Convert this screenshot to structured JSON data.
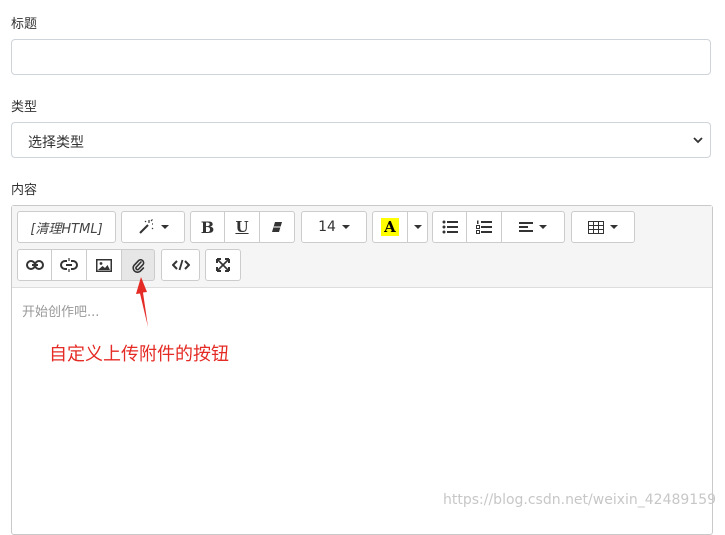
{
  "form": {
    "title_label": "标题",
    "title_value": "",
    "type_label": "类型",
    "type_selected": "选择类型",
    "content_label": "内容"
  },
  "editor": {
    "clean_html_label": "[清理HTML]",
    "font_size": "14",
    "placeholder": "开始创作吧..."
  },
  "annotation": {
    "text": "自定义上传附件的按钮",
    "color": "#e52b25"
  },
  "watermark": "https://blog.csdn.net/weixin_42489159",
  "icons": [
    "magic-icon",
    "bold-icon",
    "underline-icon",
    "eraser-icon",
    "font-color-icon",
    "unordered-list-icon",
    "ordered-list-icon",
    "align-icon",
    "table-icon",
    "link-icon",
    "unlink-icon",
    "image-icon",
    "paperclip-icon",
    "code-icon",
    "fullscreen-icon",
    "chevron-down-icon"
  ]
}
